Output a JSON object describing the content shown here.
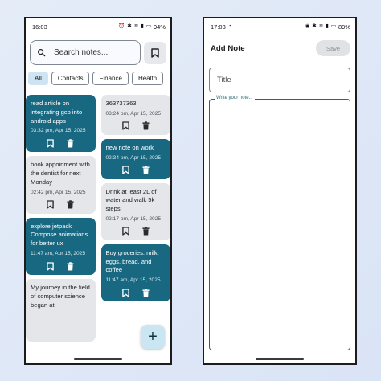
{
  "left_phone": {
    "status": {
      "time": "16:03",
      "battery": "94%",
      "icons": [
        "alarm-icon",
        "bluetooth-icon",
        "wifi-icon",
        "signal-icon",
        "battery-icon"
      ]
    },
    "search": {
      "placeholder": "Search notes..."
    },
    "chips": [
      {
        "label": "All",
        "active": true
      },
      {
        "label": "Contacts",
        "active": false
      },
      {
        "label": "Finance",
        "active": false
      },
      {
        "label": "Health",
        "active": false
      }
    ],
    "notes_col1": [
      {
        "text": "read article on integrating gcp into android apps",
        "date": "03:32 pm, Apr 15, 2025",
        "style": "dark"
      },
      {
        "text": "book appoinment with the dentist for next Monday",
        "date": "02:42 pm, Apr 15, 2025",
        "style": "light"
      },
      {
        "text": "explore jetpack Compose animations for better ux",
        "date": "11:47 am, Apr 15, 2025",
        "style": "dark"
      },
      {
        "text": "My journey in the field of computer science began at",
        "date": "",
        "style": "light"
      }
    ],
    "notes_col2": [
      {
        "text": "363737363",
        "date": "03:24 pm, Apr 15, 2025",
        "style": "light"
      },
      {
        "text": "new note on work",
        "date": "02:34 pm, Apr 15, 2025",
        "style": "dark"
      },
      {
        "text": "Drink at least 2L of water and walk 5k steps",
        "date": "02:17 pm, Apr 15, 2025",
        "style": "light"
      },
      {
        "text": "Buy groceries: milk, eggs, bread, and coffee",
        "date": "11:47 am, Apr 15, 2025",
        "style": "dark"
      }
    ],
    "fab_label": "+"
  },
  "right_phone": {
    "status": {
      "time": "17:03",
      "battery": "89%"
    },
    "header": {
      "title": "Add Note",
      "save_label": "Save"
    },
    "title_field": {
      "placeholder": "Title"
    },
    "note_field": {
      "label": "Write your note..."
    }
  },
  "colors": {
    "note_dark": "#176880",
    "note_light": "#e4e6ea",
    "chip_active": "#cfe4f2",
    "fab": "#cbe6f3",
    "accent": "#226878"
  }
}
